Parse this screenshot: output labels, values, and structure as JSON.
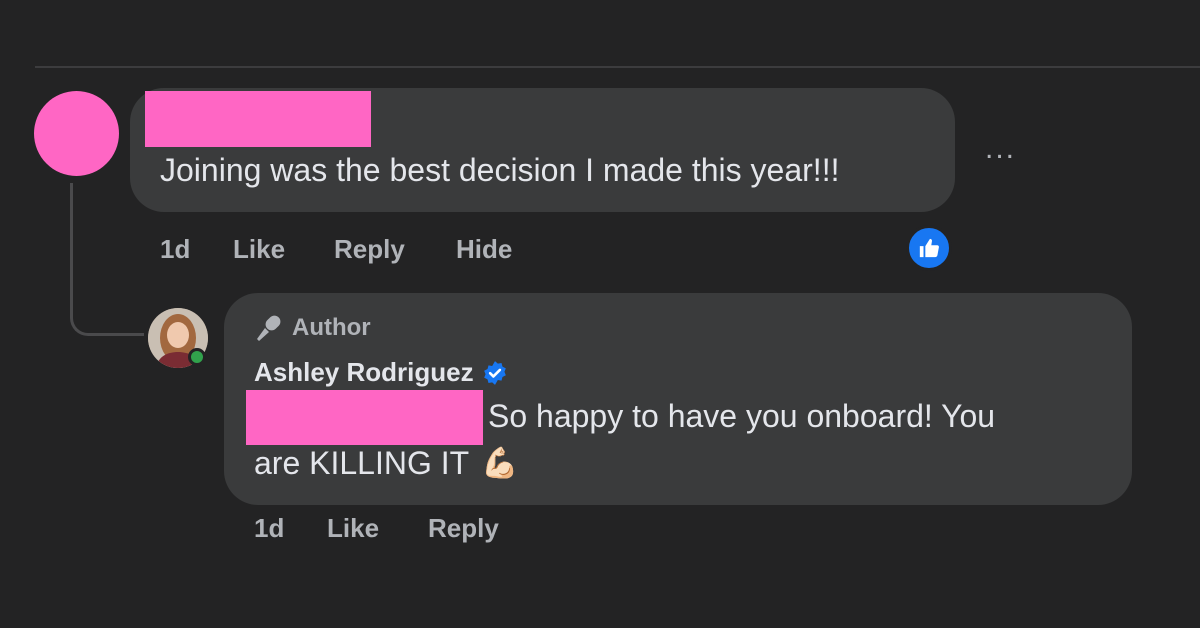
{
  "comment": {
    "text": "Joining was the best decision I made this year!!!",
    "time": "1d",
    "actions": {
      "like": "Like",
      "reply": "Reply",
      "hide": "Hide"
    },
    "more_label": "...",
    "reaction_icon": "thumbs-up-icon"
  },
  "reply": {
    "badge_label": "Author",
    "badge_icon": "microphone-icon",
    "author_name": "Ashley Rodriguez",
    "verified_icon": "verified-badge-icon",
    "text_line1": "So happy to have you onboard! You",
    "text_line2": "are KILLING IT",
    "emoji": "💪🏻",
    "time": "1d",
    "actions": {
      "like": "Like",
      "reply": "Reply"
    }
  },
  "colors": {
    "background": "#232324",
    "bubble": "#3a3b3c",
    "redaction": "#ff66c4",
    "accent": "#1877f2",
    "online": "#31a24c"
  }
}
